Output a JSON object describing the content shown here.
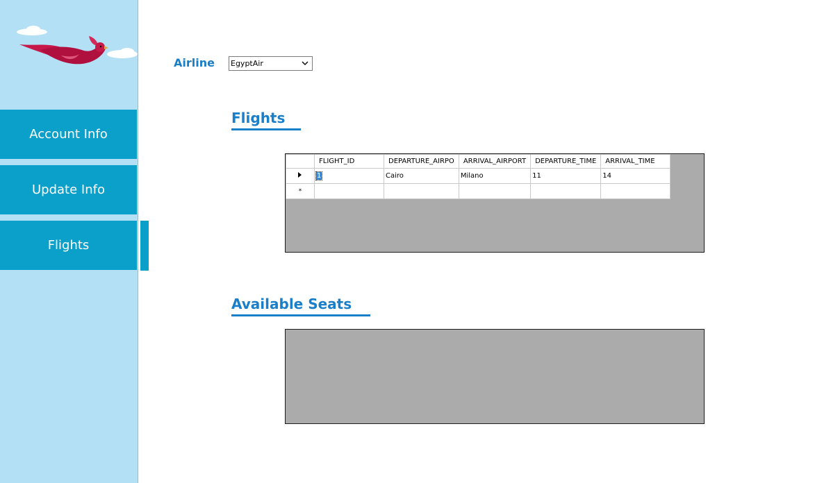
{
  "sidebar": {
    "logo_icon": "flying-red-bird-logo",
    "items": [
      {
        "label": "Account Info"
      },
      {
        "label": "Update Info"
      },
      {
        "label": "Flights",
        "active": true
      }
    ]
  },
  "airline": {
    "label": "Airline",
    "selected": "EgyptAir"
  },
  "flights": {
    "title": "Flights",
    "columns": [
      "FLIGHT_ID",
      "DEPARTURE_AIRPO",
      "ARRIVAL_AIRPORT",
      "DEPARTURE_TIME",
      "ARRIVAL_TIME"
    ],
    "rows": [
      {
        "flight_id": "1",
        "departure_airport": "Cairo",
        "arrival_airport": "Milano",
        "departure_time": "11",
        "arrival_time": "14"
      }
    ],
    "new_row_marker": "*"
  },
  "seats": {
    "title": "Available Seats"
  },
  "colors": {
    "sidebar_bg": "#b3e0f4",
    "nav_button": "#0ba0c9",
    "accent_text": "#1a7ec8",
    "grid_bg": "#ababab"
  }
}
